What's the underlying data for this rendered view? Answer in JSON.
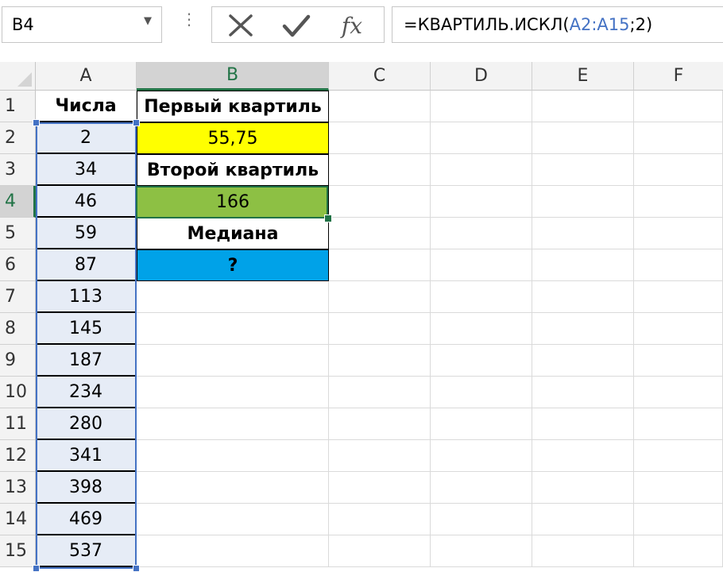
{
  "formula_bar": {
    "name_box": "B4",
    "dropdown_glyph": "▼",
    "separator_glyph": "⋮",
    "cancel_glyph": "✕",
    "enter_glyph": "✓",
    "fx_label": "fx",
    "formula_prefix": "=КВАРТИЛЬ.ИСКЛ(",
    "formula_range": "A2:A15",
    "formula_suffix": ";2)",
    "range_color": "#4472c4"
  },
  "columns": [
    "A",
    "B",
    "C",
    "D",
    "E",
    "F"
  ],
  "rows": [
    "1",
    "2",
    "3",
    "4",
    "5",
    "6",
    "7",
    "8",
    "9",
    "10",
    "11",
    "12",
    "13",
    "14",
    "15"
  ],
  "selected_column": "B",
  "selected_row": "4",
  "col_a": [
    "Числа",
    "2",
    "34",
    "46",
    "59",
    "87",
    "113",
    "145",
    "187",
    "234",
    "280",
    "341",
    "398",
    "469",
    "537"
  ],
  "col_b": [
    "Первый квартиль",
    "55,75",
    "Второй квартиль",
    "166",
    "Медиана",
    "?"
  ],
  "colors": {
    "accent": "#217346",
    "b2_fill": "#ffff00",
    "b4_fill": "#8dc044",
    "b6_fill": "#00a2e8",
    "range_fill": "#e6ecf6"
  }
}
